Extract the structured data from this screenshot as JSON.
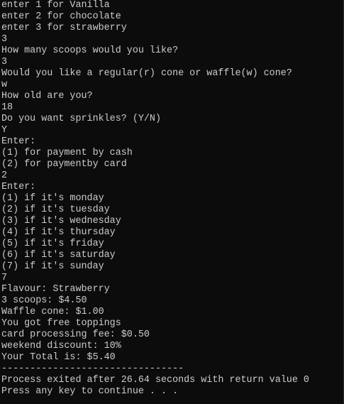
{
  "console": {
    "text_color": "#cccccc",
    "background_color": "#0c0c0c",
    "lines": [
      "enter 1 for Vanilla",
      "enter 2 for chocolate",
      "enter 3 for strawberry",
      "3",
      "How many scoops would you like?",
      "3",
      "Would you like a regular(r) cone or waffle(w) cone?",
      "w",
      "How old are you?",
      "18",
      "Do you want sprinkles? (Y/N)",
      "Y",
      "Enter:",
      "(1) for payment by cash",
      "(2) for paymentby card",
      "2",
      "Enter:",
      "(1) if it's monday",
      "(2) if it's tuesday",
      "(3) if it's wednesday",
      "(4) if it's thursday",
      "(5) if it's friday",
      "(6) if it's saturday",
      "(7) if it's sunday",
      "7",
      "Flavour: Strawberry",
      "3 scoops: $4.50",
      "Waffle cone: $1.00",
      "You got free toppings",
      "card processing fee: $0.50",
      "weekend discount: 10%",
      "Your Total is: $5.40",
      "--------------------------------",
      "Process exited after 26.64 seconds with return value 0",
      "Press any key to continue . . ."
    ]
  }
}
